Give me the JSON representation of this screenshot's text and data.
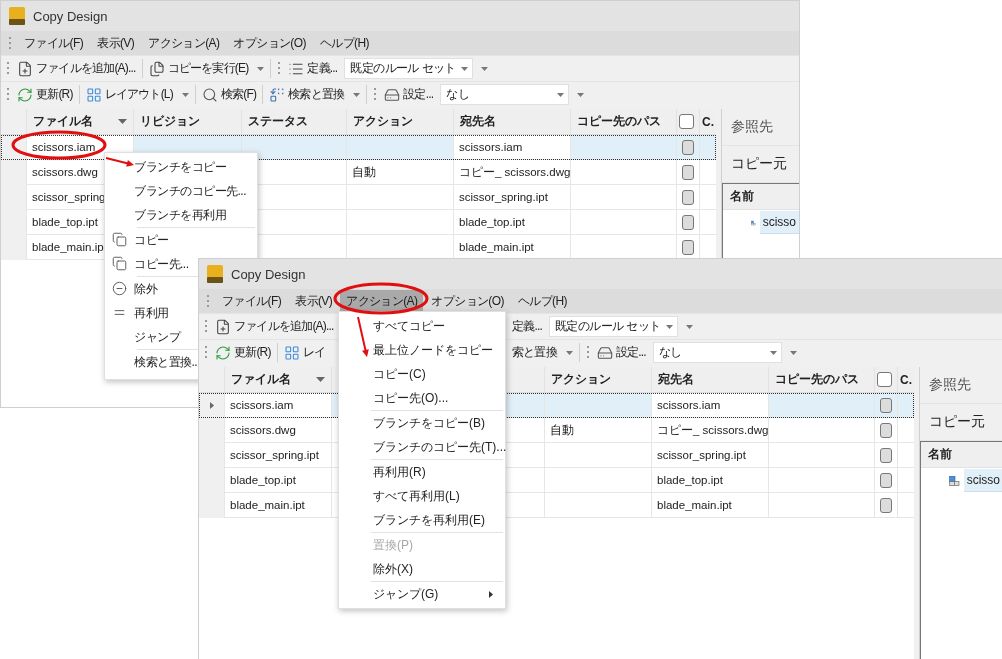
{
  "windows": [
    {
      "title": "Copy Design",
      "menu_open": false,
      "menubar": [
        {
          "label": "ファイル(F)",
          "selected": false
        },
        {
          "label": "表示(V)",
          "selected": false
        },
        {
          "label": "アクション(A)",
          "selected": false
        },
        {
          "label": "オプション(O)",
          "selected": false
        },
        {
          "label": "ヘルプ(H)",
          "selected": false
        }
      ],
      "toolbar_rows": [
        [
          [
            {
              "kind": "add-file",
              "label": "ファイルを追加(A)...",
              "dropdown": false
            },
            {
              "kind": "run-copy",
              "label": "コピーを実行(E)",
              "dropdown": true
            }
          ],
          [
            {
              "kind": "define",
              "label": "定義...",
              "dropdown": false
            },
            {
              "kind": "combo",
              "value": "既定のルール セット"
            }
          ]
        ],
        [
          [
            {
              "kind": "refresh",
              "label": "更新(R)",
              "dropdown": false
            },
            {
              "kind": "layout",
              "label": "レイアウト(L)",
              "dropdown": true
            },
            {
              "kind": "search",
              "label": "検索(F)",
              "dropdown": false
            },
            {
              "kind": "replace",
              "label": "検索と置換",
              "dropdown": true
            }
          ],
          [
            {
              "kind": "settings",
              "label": "設定...",
              "dropdown": false
            },
            {
              "kind": "combo",
              "value": "なし"
            }
          ]
        ]
      ],
      "table": {
        "columns": [
          {
            "kind": "name",
            "label": "ファイル名"
          },
          {
            "kind": "revision",
            "label": "リビジョン"
          },
          {
            "kind": "status",
            "label": "ステータス"
          },
          {
            "kind": "action",
            "label": "アクション"
          },
          {
            "kind": "destination",
            "label": "宛先名"
          },
          {
            "kind": "path",
            "label": "コピー先のパス"
          },
          {
            "kind": "check",
            "checked": false
          },
          {
            "kind": "c",
            "label": "C."
          }
        ],
        "rows": [
          {
            "selected": true,
            "current": false,
            "name": "scissors.iam",
            "destination": "scissors.iam",
            "checked": false
          },
          {
            "selected": false,
            "current": false,
            "name": "scissors.dwg",
            "action": "自動",
            "destination": "コピー_ scissors.dwg",
            "checked": false
          },
          {
            "selected": false,
            "current": false,
            "name": "scissor_spring",
            "destination": "scissor_spring.ipt",
            "checked": false
          },
          {
            "selected": false,
            "current": false,
            "name": "blade_top.ipt",
            "destination": "blade_top.ipt",
            "checked": false
          },
          {
            "selected": false,
            "current": false,
            "name": "blade_main.ip",
            "destination": "blade_main.ipt",
            "checked": false
          }
        ]
      },
      "side_panel": {
        "sections": [
          {
            "label": "参照先",
            "expanded": false
          },
          {
            "label": "コピー元",
            "expanded": true
          }
        ],
        "tree_header": "名前",
        "tree_items": [
          {
            "label": "scisso",
            "selected": true
          }
        ]
      },
      "context_menu": {
        "groups": [
          [
            {
              "kind": "plain",
              "label": "ブランチをコピー"
            },
            {
              "kind": "plain",
              "label": "ブランチのコピー先..."
            },
            {
              "kind": "plain",
              "label": "ブランチを再利用"
            }
          ],
          [
            {
              "kind": "copy",
              "label": "コピー"
            },
            {
              "kind": "copy",
              "label": "コピー先..."
            }
          ],
          [
            {
              "kind": "exclude",
              "label": "除外"
            },
            {
              "kind": "reuse",
              "label": "再利用"
            },
            {
              "kind": "plain",
              "label": "ジャンプ"
            }
          ],
          [
            {
              "kind": "plain",
              "label": "検索と置換.."
            }
          ]
        ]
      }
    },
    {
      "title": "Copy Design",
      "menu_open": true,
      "menubar": [
        {
          "label": "ファイル(F)",
          "selected": false
        },
        {
          "label": "表示(V)",
          "selected": false
        },
        {
          "label": "アクション(A)",
          "selected": true
        },
        {
          "label": "オプション(O)",
          "selected": false
        },
        {
          "label": "ヘルプ(H)",
          "selected": false
        }
      ],
      "toolbar_rows": [
        [
          [
            {
              "kind": "add-file",
              "label": "ファイルを追加(A)...",
              "dropdown": false
            }
          ],
          [
            {
              "kind": "text",
              "label": "定義...",
              "dropdown": false
            },
            {
              "kind": "combo",
              "value": "既定のルール セット"
            }
          ]
        ],
        [
          [
            {
              "kind": "refresh",
              "label": "更新(R)",
              "dropdown": false
            },
            {
              "kind": "layout",
              "label": "レイ",
              "dropdown": false
            }
          ],
          [
            {
              "kind": "text",
              "label": "索と置換",
              "dropdown": true
            }
          ],
          [
            {
              "kind": "settings",
              "label": "設定...",
              "dropdown": false
            },
            {
              "kind": "combo",
              "value": "なし"
            }
          ]
        ]
      ],
      "table": {
        "columns": [
          {
            "kind": "name",
            "label": "ファイル名"
          },
          {
            "kind": "revision"
          },
          {
            "kind": "status"
          },
          {
            "kind": "action",
            "label": "アクション"
          },
          {
            "kind": "destination",
            "label": "宛先名"
          },
          {
            "kind": "path",
            "label": "コピー先のパス"
          },
          {
            "kind": "check",
            "checked": false
          },
          {
            "kind": "c",
            "label": "C."
          }
        ],
        "rows": [
          {
            "selected": true,
            "current": true,
            "name": "scissors.iam",
            "destination": "scissors.iam",
            "checked": false
          },
          {
            "selected": false,
            "current": false,
            "name": "scissors.dwg",
            "action": "自動",
            "destination": "コピー_ scissors.dwg",
            "checked": false
          },
          {
            "selected": false,
            "current": false,
            "name": "scissor_spring.ipt",
            "destination": "scissor_spring.ipt",
            "checked": false
          },
          {
            "selected": false,
            "current": false,
            "name": "blade_top.ipt",
            "destination": "blade_top.ipt",
            "checked": false
          },
          {
            "selected": false,
            "current": false,
            "name": "blade_main.ipt",
            "destination": "blade_main.ipt",
            "checked": false
          }
        ]
      },
      "side_panel": {
        "sections": [
          {
            "label": "参照先",
            "expanded": false
          },
          {
            "label": "コピー元",
            "expanded": true
          }
        ],
        "tree_header": "名前",
        "tree_items": [
          {
            "label": "scisso",
            "selected": true
          }
        ]
      },
      "dropdown_menu": {
        "groups": [
          [
            {
              "label": "すべてコピー",
              "disabled": false,
              "submenu": false
            },
            {
              "label": "最上位ノードをコピー",
              "disabled": false,
              "submenu": false
            },
            {
              "label": "コピー(C)",
              "disabled": false,
              "submenu": false
            },
            {
              "label": "コピー先(O)...",
              "disabled": false,
              "submenu": false
            }
          ],
          [
            {
              "label": "ブランチをコピー(B)",
              "disabled": false,
              "submenu": false
            },
            {
              "label": "ブランチのコピー先(T)...",
              "disabled": false,
              "submenu": false
            }
          ],
          [
            {
              "label": "再利用(R)",
              "disabled": false,
              "submenu": false
            },
            {
              "label": "すべて再利用(L)",
              "disabled": false,
              "submenu": false
            },
            {
              "label": "ブランチを再利用(E)",
              "disabled": false,
              "submenu": false
            }
          ],
          [
            {
              "label": "置換(P)",
              "disabled": true,
              "submenu": false
            },
            {
              "label": "除外(X)",
              "disabled": false,
              "submenu": false
            }
          ],
          [
            {
              "label": "ジャンプ(G)",
              "disabled": false,
              "submenu": true
            }
          ]
        ]
      }
    }
  ]
}
